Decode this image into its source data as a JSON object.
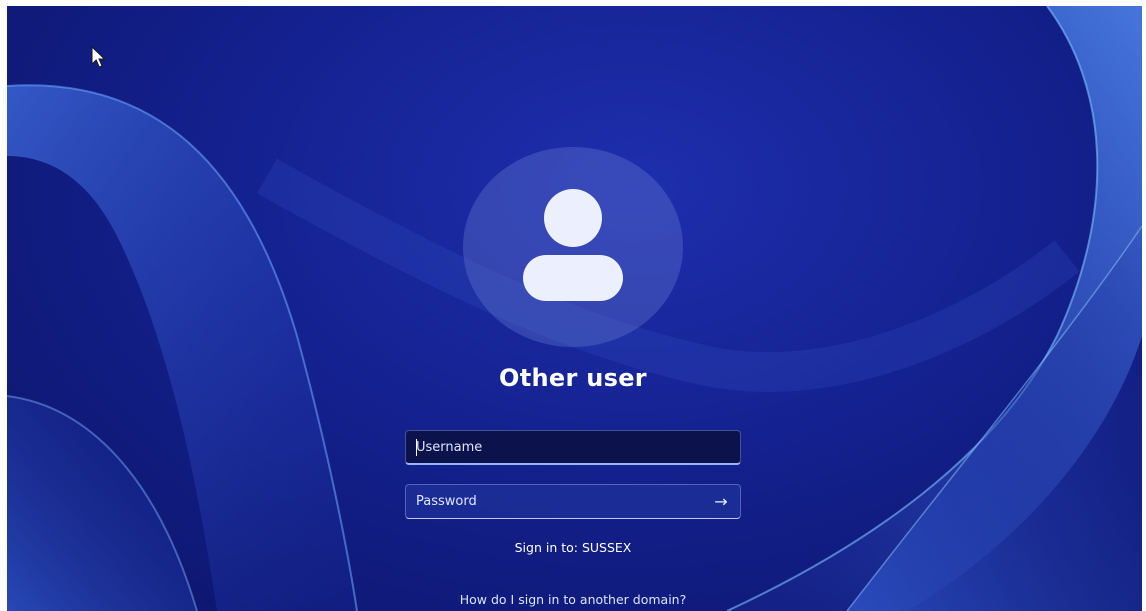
{
  "login": {
    "title": "Other user",
    "username": {
      "value": "",
      "placeholder": "Username"
    },
    "password": {
      "value": "",
      "placeholder": "Password"
    },
    "submit_icon": "arrow-right-icon",
    "submit_glyph": "→",
    "sign_in_to": "Sign in to: SUSSEX",
    "help_link": "How do I sign in to another domain?"
  },
  "icons": {
    "avatar": "user-silhouette-icon",
    "cursor": "mouse-pointer-icon"
  },
  "colors": {
    "background": "#14218f",
    "text": "#ffffff",
    "avatar_glyph": "#eceffd"
  }
}
